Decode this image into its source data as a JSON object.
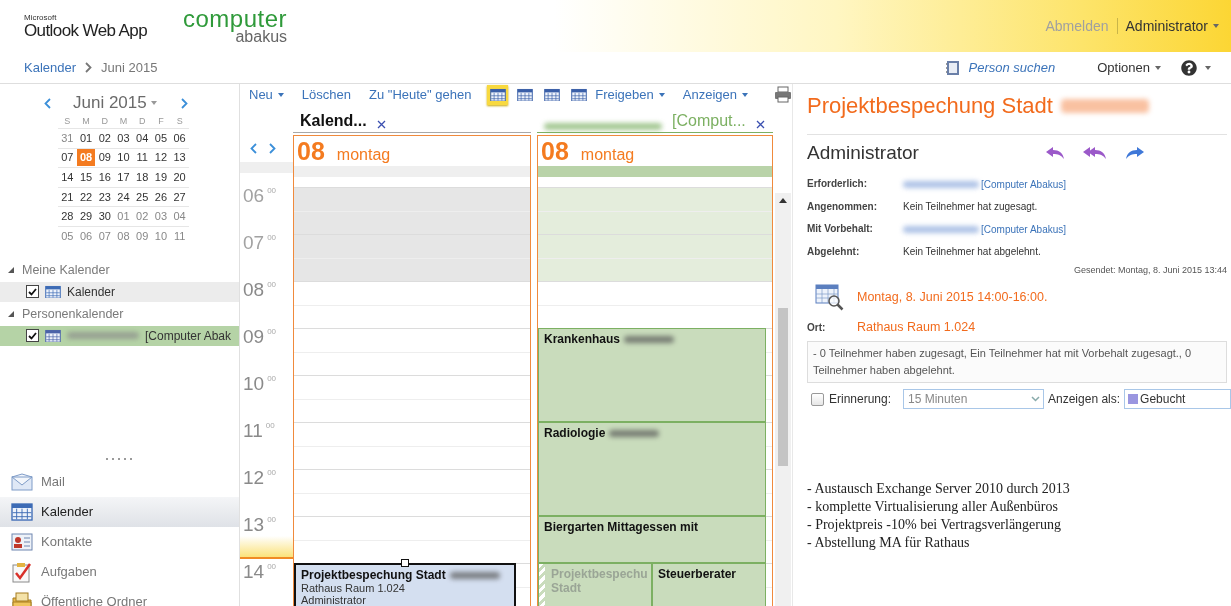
{
  "header": {
    "logo_small": "Microsoft",
    "logo": "Outlook Web App",
    "brand_top": "computer",
    "brand_bottom": "abakus",
    "signout": "Abmelden",
    "user": "Administrator"
  },
  "breadcrumb": [
    "Kalender",
    "Juni 2015"
  ],
  "top_links": {
    "person_search": "Person suchen",
    "options": "Optionen"
  },
  "mini_calendar": {
    "month": "Juni 2015",
    "weekdays": [
      "S",
      "M",
      "D",
      "M",
      "D",
      "F",
      "S"
    ],
    "weeks": [
      [
        {
          "label": "31",
          "other_month": true,
          "selected": false
        },
        {
          "label": "01",
          "other_month": false,
          "selected": false
        },
        {
          "label": "02",
          "other_month": false,
          "selected": false
        },
        {
          "label": "03",
          "other_month": false,
          "selected": false
        },
        {
          "label": "04",
          "other_month": false,
          "selected": false
        },
        {
          "label": "05",
          "other_month": false,
          "selected": false
        },
        {
          "label": "06",
          "other_month": false,
          "selected": false
        }
      ],
      [
        {
          "label": "07",
          "other_month": false,
          "selected": false
        },
        {
          "label": "08",
          "other_month": false,
          "selected": true
        },
        {
          "label": "09",
          "other_month": false,
          "selected": false
        },
        {
          "label": "10",
          "other_month": false,
          "selected": false
        },
        {
          "label": "11",
          "other_month": false,
          "selected": false
        },
        {
          "label": "12",
          "other_month": false,
          "selected": false
        },
        {
          "label": "13",
          "other_month": false,
          "selected": false
        }
      ],
      [
        {
          "label": "14",
          "other_month": false,
          "selected": false
        },
        {
          "label": "15",
          "other_month": false,
          "selected": false
        },
        {
          "label": "16",
          "other_month": false,
          "selected": false
        },
        {
          "label": "17",
          "other_month": false,
          "selected": false
        },
        {
          "label": "18",
          "other_month": false,
          "selected": false
        },
        {
          "label": "19",
          "other_month": false,
          "selected": false
        },
        {
          "label": "20",
          "other_month": false,
          "selected": false
        }
      ],
      [
        {
          "label": "21",
          "other_month": false,
          "selected": false
        },
        {
          "label": "22",
          "other_month": false,
          "selected": false
        },
        {
          "label": "23",
          "other_month": false,
          "selected": false
        },
        {
          "label": "24",
          "other_month": false,
          "selected": false
        },
        {
          "label": "25",
          "other_month": false,
          "selected": false
        },
        {
          "label": "26",
          "other_month": false,
          "selected": false
        },
        {
          "label": "27",
          "other_month": false,
          "selected": false
        }
      ],
      [
        {
          "label": "28",
          "other_month": false,
          "selected": false
        },
        {
          "label": "29",
          "other_month": false,
          "selected": false
        },
        {
          "label": "30",
          "other_month": false,
          "selected": false
        },
        {
          "label": "01",
          "other_month": true,
          "selected": false
        },
        {
          "label": "02",
          "other_month": true,
          "selected": false
        },
        {
          "label": "03",
          "other_month": true,
          "selected": false
        },
        {
          "label": "04",
          "other_month": true,
          "selected": false
        }
      ],
      [
        {
          "label": "05",
          "other_month": true,
          "selected": false
        },
        {
          "label": "06",
          "other_month": true,
          "selected": false
        },
        {
          "label": "07",
          "other_month": true,
          "selected": false
        },
        {
          "label": "08",
          "other_month": true,
          "selected": false
        },
        {
          "label": "09",
          "other_month": true,
          "selected": false
        },
        {
          "label": "10",
          "other_month": true,
          "selected": false
        },
        {
          "label": "11",
          "other_month": true,
          "selected": false
        }
      ]
    ]
  },
  "calendar_groups": [
    {
      "title": "Meine Kalender",
      "expanded": true,
      "items": [
        {
          "name": "Kalender",
          "redacted": false,
          "checked": true,
          "color": "#ececec"
        }
      ]
    },
    {
      "title": "Personenkalender",
      "expanded": true,
      "items": [
        {
          "name": "[Computer Abak",
          "redacted": true,
          "checked": true,
          "color": "#b5d3a6"
        }
      ]
    }
  ],
  "navigation": [
    {
      "label": "Mail",
      "selected": false
    },
    {
      "label": "Kalender",
      "selected": true
    },
    {
      "label": "Kontakte",
      "selected": false
    },
    {
      "label": "Aufgaben",
      "selected": false
    },
    {
      "label": "Öffentliche Ordner",
      "selected": false
    }
  ],
  "toolbar": [
    {
      "kind": "menu",
      "label": "Neu"
    },
    {
      "kind": "link",
      "label": "Löschen"
    },
    {
      "kind": "link",
      "label": "Zu \"Heute\" gehen"
    },
    {
      "kind": "view",
      "selected": true
    },
    {
      "kind": "view",
      "selected": false
    },
    {
      "kind": "view",
      "selected": false
    },
    {
      "kind": "view",
      "selected": false
    },
    {
      "kind": "menu",
      "label": "Freigeben"
    },
    {
      "kind": "menu",
      "label": "Anzeigen"
    },
    {
      "kind": "print"
    }
  ],
  "hours": [
    {
      "label": "06",
      "minutes": "00",
      "working": false,
      "current": false
    },
    {
      "label": "07",
      "minutes": "00",
      "working": false,
      "current": false
    },
    {
      "label": "08",
      "minutes": "00",
      "working": true,
      "current": false
    },
    {
      "label": "09",
      "minutes": "00",
      "working": true,
      "current": false
    },
    {
      "label": "10",
      "minutes": "00",
      "working": true,
      "current": false
    },
    {
      "label": "11",
      "minutes": "00",
      "working": true,
      "current": false
    },
    {
      "label": "12",
      "minutes": "00",
      "working": true,
      "current": false
    },
    {
      "label": "13",
      "minutes": "00",
      "working": true,
      "current": true
    },
    {
      "label": "14",
      "minutes": "00",
      "working": true,
      "current": false
    }
  ],
  "calendars": [
    {
      "title": "Kalend...",
      "redacted": false,
      "selected": true,
      "color": "#a8a8a8",
      "day": {
        "number": "08",
        "weekday": "montag"
      },
      "events": [
        {
          "title": "Projektbespechung Stadt",
          "redacted": true,
          "location": "Rathaus Raum 1.024",
          "organizer": "Administrator",
          "color": "#d4dff0",
          "selected": true,
          "tentative": false
        }
      ]
    },
    {
      "title": "[Comput...",
      "redacted": true,
      "selected": false,
      "color": "#7cb062",
      "day": {
        "number": "08",
        "weekday": "montag"
      },
      "events": [
        {
          "title": "Krankenhaus",
          "redacted": true,
          "color": "#c9dcbc",
          "selected": false,
          "tentative": false
        },
        {
          "title": "Radiologie",
          "redacted": true,
          "color": "#c9dcbc",
          "selected": false,
          "tentative": false
        },
        {
          "title": "Biergarten Mittagessen mit",
          "redacted": false,
          "color": "#c9dcbc",
          "selected": false,
          "tentative": false
        },
        {
          "title": "Projektbespechu\nStadt",
          "redacted": false,
          "color": "#c9dcbc",
          "selected": false,
          "tentative": true
        },
        {
          "title": "Steuerberater",
          "redacted": false,
          "color": "#c9dcbc",
          "selected": false,
          "tentative": false
        }
      ]
    }
  ],
  "details": {
    "subject": "Projektbespechung Stadt",
    "subject_redacted": true,
    "sender": "Administrator",
    "attendees": [
      {
        "label": "Erforderlich:",
        "value": "[Computer Abakus]",
        "redacted": true,
        "link": true
      },
      {
        "label": "Angenommen:",
        "value": "Kein Teilnehmer hat zugesagt.",
        "redacted": false,
        "link": false
      },
      {
        "label": "Mit Vorbehalt:",
        "value": "[Computer Abakus]",
        "redacted": true,
        "link": true
      },
      {
        "label": "Abgelehnt:",
        "value": "Kein Teilnehmer hat abgelehnt.",
        "redacted": false,
        "link": false
      }
    ],
    "sent": "Gesendet: Montag, 8. Juni 2015 13:44",
    "when": "Montag, 8. Juni 2015 14:00-16:00.",
    "location_label": "Ort:",
    "location": "Rathaus Raum 1.024",
    "summary": "- 0 Teilnehmer haben zugesagt, Ein Teilnehmer hat mit Vorbehalt zugesagt., 0 Teilnehmer haben abgelehnt.",
    "reminder": {
      "label": "Erinnerung:",
      "checked": false,
      "value": "15 Minuten",
      "disabled": true
    },
    "show_as": {
      "label": "Anzeigen als:",
      "value": "Gebucht",
      "color": "#9a96e0"
    },
    "body": [
      "- Austausch Exchange Server 2010 durch 2013",
      "- komplette Virtualisierung aller Außenbüros",
      "- Projektpreis -10% bei Vertragsverlängerung",
      "- Abstellung MA für Rathaus"
    ]
  }
}
